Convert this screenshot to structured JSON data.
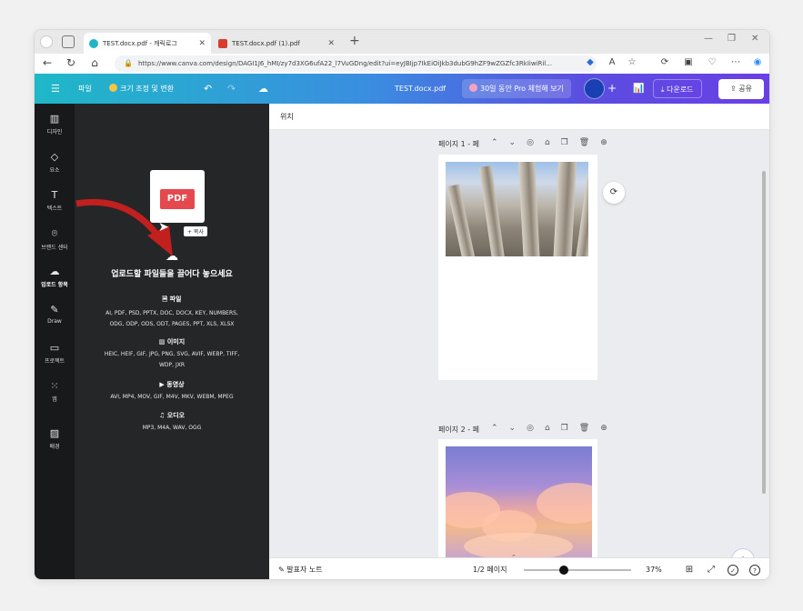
{
  "browser": {
    "tabs": [
      {
        "title": "TEST.docx.pdf - 캐릭로그",
        "active": true
      },
      {
        "title": "TEST.docx.pdf (1).pdf",
        "active": false
      }
    ],
    "url": "https://www.canva.com/design/DAGI1J6_hMI/zy7d3XG6ufA22_l7VuGDng/edit?ui=eyJBIjp7IkEiOiJkb3dubG9hZF9wZGZfc3RkIiwiRil..."
  },
  "canva": {
    "menu_label": "파일",
    "resize_label": "크기 조정 및 변환",
    "doc_title": "TEST.docx.pdf",
    "pro_trial_label": "30일 동안 Pro 체험해 보기",
    "download_label": "다운로드",
    "share_label": "공유"
  },
  "rail": [
    {
      "label": "디자인",
      "icon": "layout-icon"
    },
    {
      "label": "요소",
      "icon": "shapes-icon"
    },
    {
      "label": "텍스트",
      "icon": "text-icon"
    },
    {
      "label": "브랜드 센터",
      "icon": "brand-icon"
    },
    {
      "label": "업로드 항목",
      "icon": "upload-icon"
    },
    {
      "label": "Draw",
      "icon": "draw-icon"
    },
    {
      "label": "프로젝트",
      "icon": "folder-icon"
    },
    {
      "label": "앱",
      "icon": "apps-icon"
    },
    {
      "label": "배경",
      "icon": "background-icon"
    }
  ],
  "upload_panel": {
    "pdf_label": "PDF",
    "copy_tag": "+ 복사",
    "drop_title": "업로드할 파일들을 끌어다 놓으세요",
    "categories": [
      {
        "heading": "파일",
        "line1": "AI, PDF, PSD, PPTX, DOC, DOCX, KEY, NUMBERS,",
        "line2": "ODG, ODP, ODS, ODT, PAGES, PPT, XLS, XLSX"
      },
      {
        "heading": "이미지",
        "line1": "HEIC, HEIF, GIF, JPG, PNG, SVG, AVIF, WEBP, TIFF,",
        "line2": "WDP, JXR"
      },
      {
        "heading": "동영상",
        "line1": "AVI, MP4, MOV, GIF, M4V, MKV, WEBM, MPEG",
        "line2": ""
      },
      {
        "heading": "오디오",
        "line1": "MP3, M4A, WAV, OGG",
        "line2": ""
      }
    ]
  },
  "editor": {
    "position_label": "위치",
    "page1_title": "페이지 1 - 페",
    "page2_title": "페이지 2 - 페"
  },
  "bottombar": {
    "notes_label": "발표자 노트",
    "page_counter": "1/2 페이지",
    "zoom": "37%",
    "zoom_level": 0.37
  }
}
